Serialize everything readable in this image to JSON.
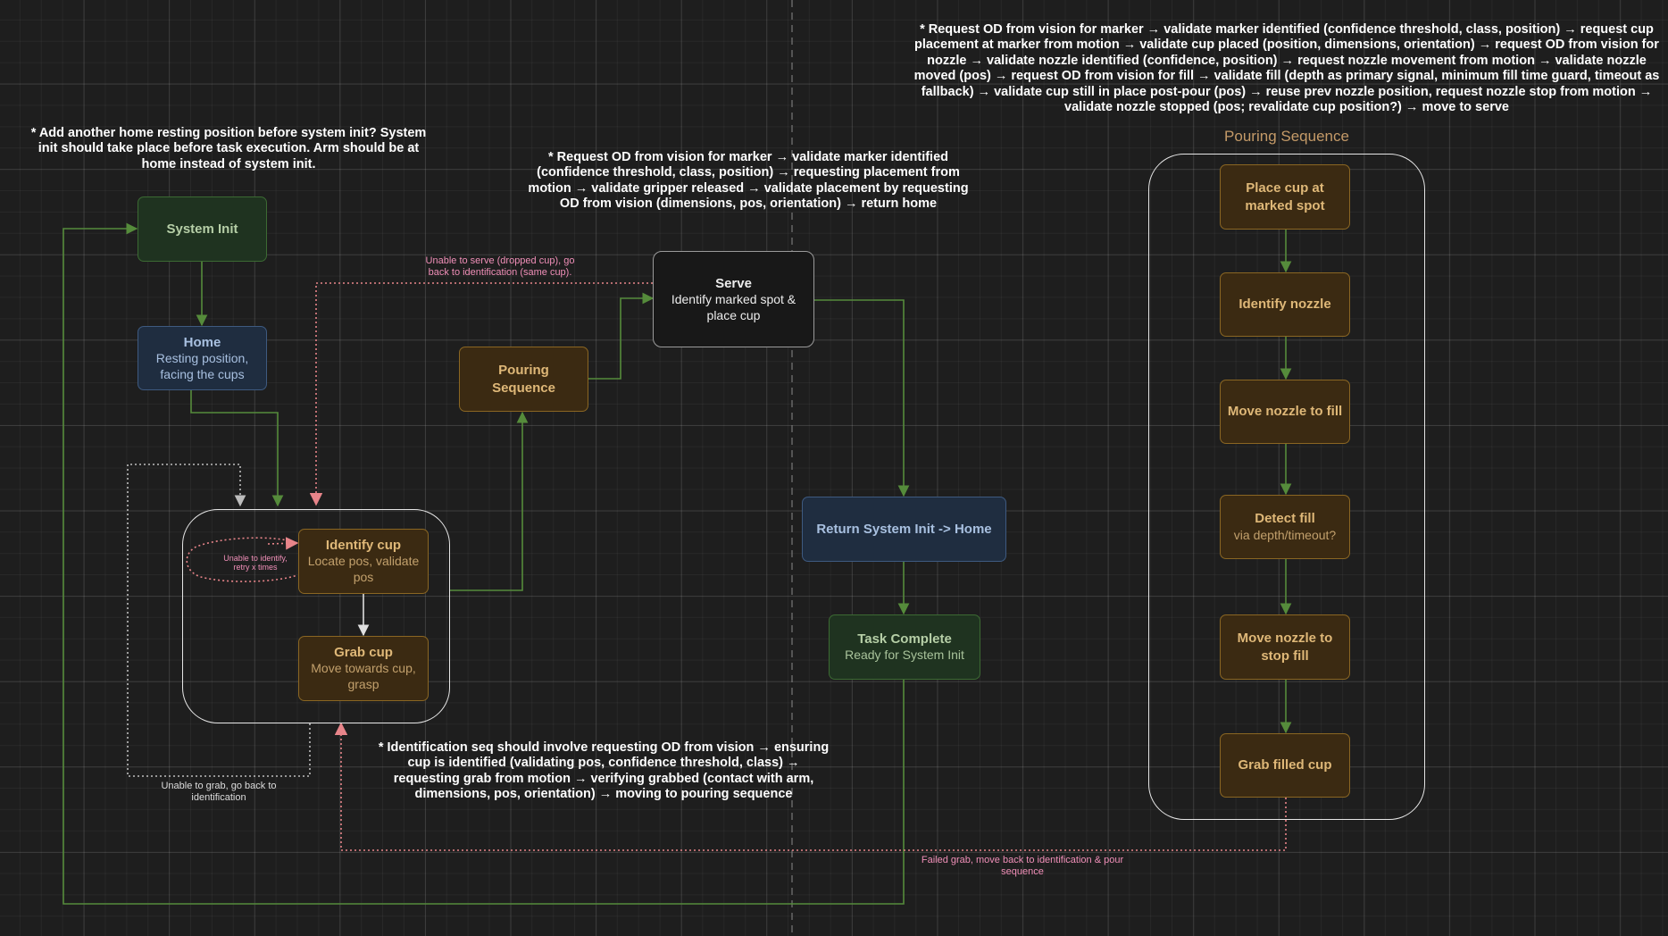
{
  "nodes": {
    "system_init": {
      "title": "System Init"
    },
    "home": {
      "title": "Home",
      "subtitle": "Resting position, facing the cups"
    },
    "identify_cup": {
      "title": "Identify cup",
      "subtitle": "Locate pos, validate pos"
    },
    "grab_cup": {
      "title": "Grab cup",
      "subtitle": "Move towards cup, grasp"
    },
    "pouring_sequence": {
      "title": "Pouring Sequence"
    },
    "serve": {
      "title": "Serve",
      "subtitle": "Identify marked spot & place cup"
    },
    "return_init": {
      "title": "Return System Init -> Home"
    },
    "task_complete": {
      "title": "Task Complete",
      "subtitle": "Ready for System Init"
    },
    "place_cup": {
      "title": "Place cup at marked spot"
    },
    "identify_nozzle": {
      "title": "Identify nozzle"
    },
    "move_nozzle_fill": {
      "title": "Move nozzle to fill"
    },
    "detect_fill": {
      "title": "Detect fill",
      "subtitle": "via depth/timeout?"
    },
    "move_nozzle_stop": {
      "title": "Move nozzle to stop fill"
    },
    "grab_filled": {
      "title": "Grab filled cup"
    }
  },
  "group_label": "Pouring Sequence",
  "notes": {
    "home_note": "* Add another home resting position before system init? System init should take place before task execution. Arm should be at home instead of system init.",
    "serve_note": "* Request OD from vision for marker → validate marker identified (confidence threshold, class, position)  → requesting placement from motion → validate gripper released → validate placement by requesting OD from vision (dimensions, pos, orientation) → return home",
    "pour_note": "* Request OD from vision for marker → validate marker identified (confidence threshold, class, position) → request cup placement at marker from motion → validate cup placed (position, dimensions, orientation) → request OD from vision for nozzle → validate nozzle identified (confidence, position) → request nozzle movement from motion → validate nozzle moved (pos) → request OD from vision for fill → validate fill (depth as primary signal, minimum fill time guard, timeout as fallback) → validate cup still in place post-pour (pos) → reuse prev nozzle position, request nozzle stop from motion → validate nozzle stopped (pos; revalidate cup position?) → move to serve",
    "ident_note": "* Identification seq should involve requesting OD from vision → ensuring cup is identified (validating pos, confidence threshold, class) → requesting grab from motion → verifying grabbed (contact with arm, dimensions, pos, orientation) → moving to pouring sequence"
  },
  "edge_labels": {
    "serve_fail": "Unable to serve (dropped cup), go back to identification (same cup).",
    "identify_retry": "Unable to identify, retry x times",
    "grab_fail": "Unable to grab, go back to identification",
    "failed_grab_pour": "Failed grab, move back to identification & pour sequence"
  },
  "colors": {
    "green_edge": "#558b3b",
    "pink_edge": "#e8858a",
    "white_edge": "#e0e0e0",
    "grey_dotted": "#bdbdbd"
  }
}
